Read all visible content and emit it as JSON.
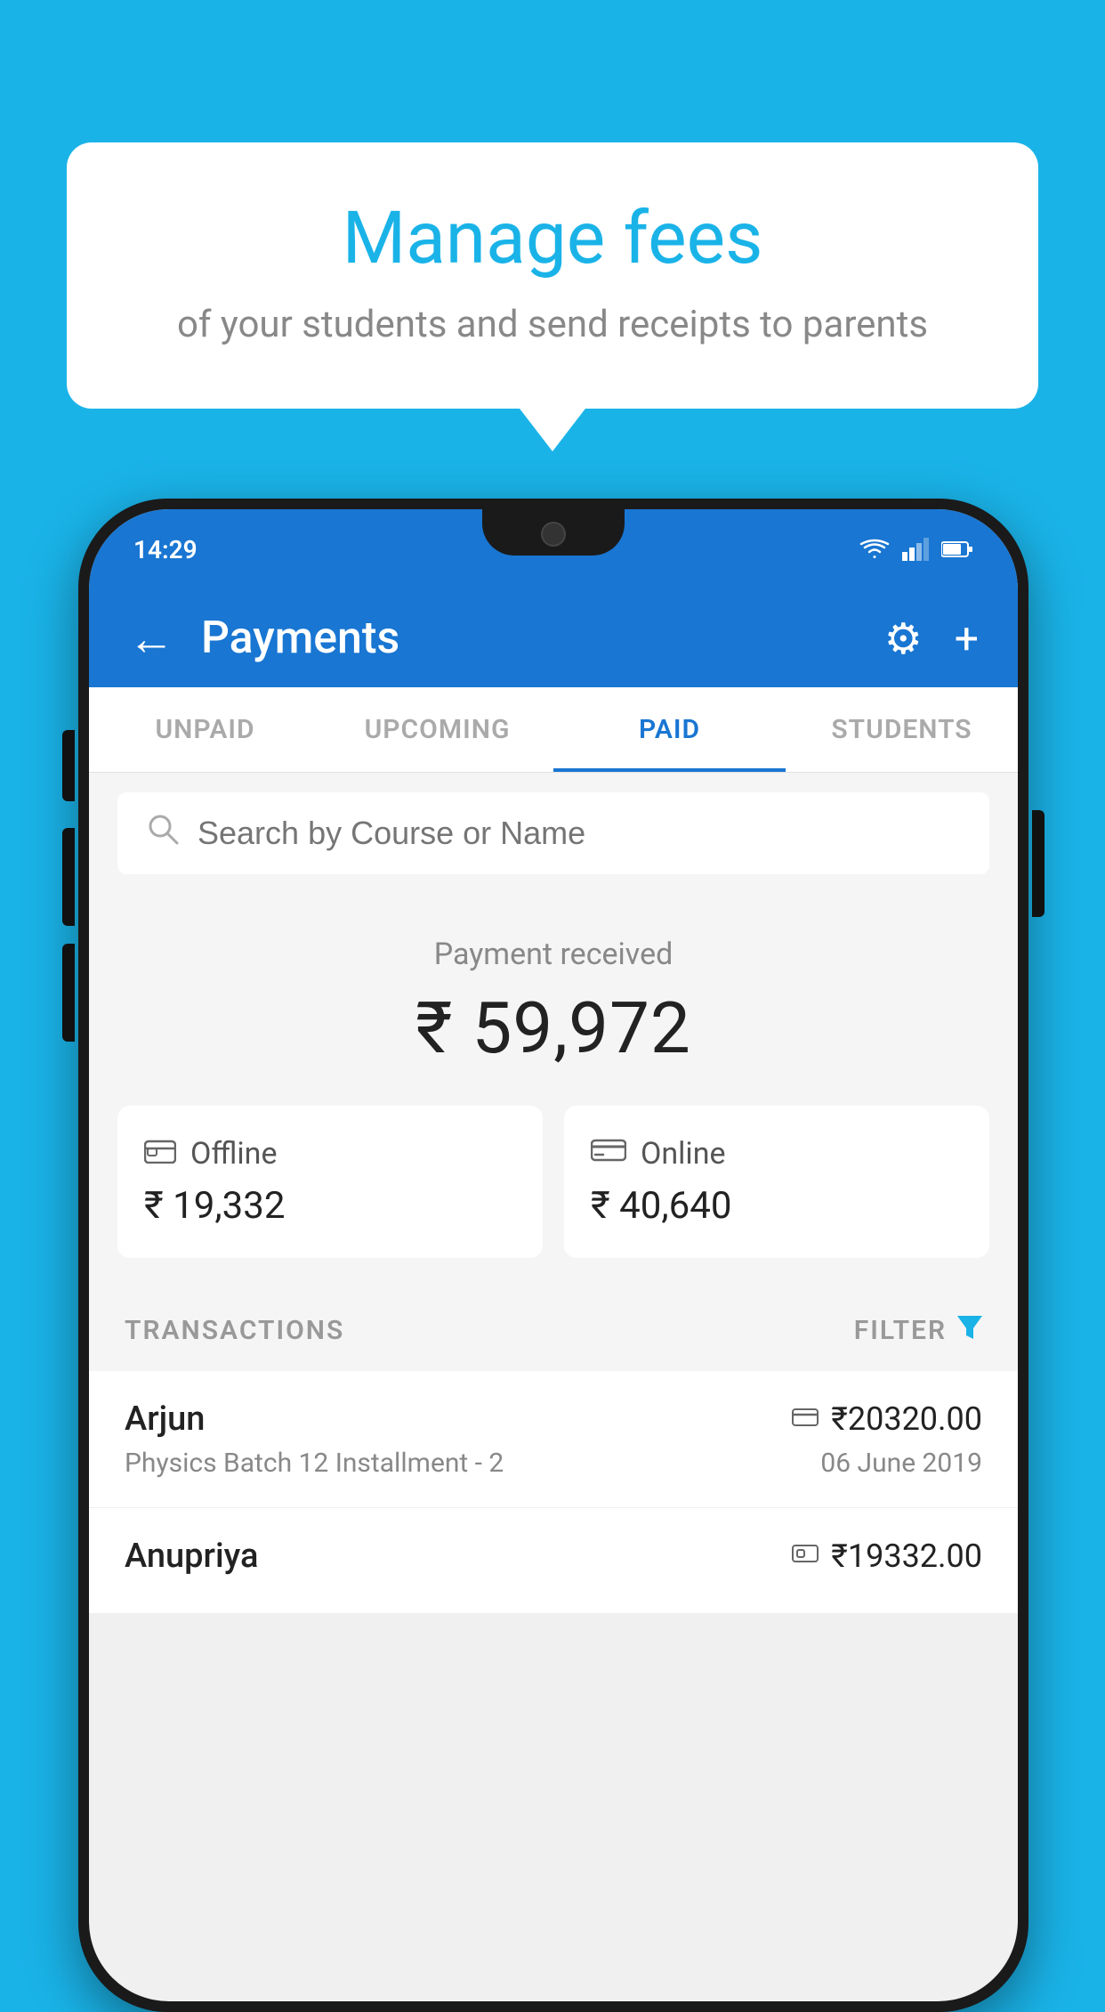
{
  "background_color": "#1ab3e8",
  "speech_bubble": {
    "title": "Manage fees",
    "subtitle": "of your students and send receipts to parents"
  },
  "phone": {
    "status_bar": {
      "time": "14:29",
      "icons": [
        "wifi",
        "signal",
        "battery"
      ]
    },
    "app_bar": {
      "back_icon": "←",
      "title": "Payments",
      "settings_icon": "⚙",
      "add_icon": "+"
    },
    "tabs": [
      {
        "label": "UNPAID",
        "active": false
      },
      {
        "label": "UPCOMING",
        "active": false
      },
      {
        "label": "PAID",
        "active": true
      },
      {
        "label": "STUDENTS",
        "active": false
      }
    ],
    "search": {
      "placeholder": "Search by Course or Name",
      "icon": "🔍"
    },
    "payment_summary": {
      "label": "Payment received",
      "amount": "₹ 59,972",
      "offline": {
        "label": "Offline",
        "amount": "₹ 19,332",
        "icon": "💳"
      },
      "online": {
        "label": "Online",
        "amount": "₹ 40,640",
        "icon": "💳"
      }
    },
    "transactions_header": {
      "label": "TRANSACTIONS",
      "filter_label": "FILTER",
      "filter_icon": "▼"
    },
    "transactions": [
      {
        "name": "Arjun",
        "course": "Physics Batch 12 Installment - 2",
        "amount": "₹20320.00",
        "date": "06 June 2019",
        "type_icon": "card"
      },
      {
        "name": "Anupriya",
        "course": "",
        "amount": "₹19332.00",
        "date": "",
        "type_icon": "cash"
      }
    ]
  }
}
